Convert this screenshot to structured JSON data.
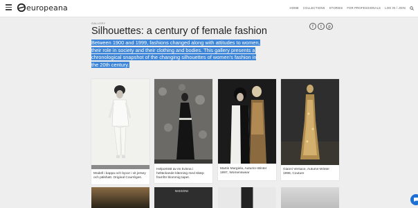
{
  "header": {
    "logo_text": "europeana",
    "nav": [
      "HOME",
      "COLLECTIONS",
      "STORIES",
      "FOR PROFESSIONALS",
      "LOG IN / JOIN"
    ]
  },
  "gallery": {
    "tag": "GALLERY",
    "title": "Silhouettes: a century of female fashion",
    "intro": "Between 1900 and 1999, fashions changed along with attitudes to women, their role in society and their clothing and bodies. This gallery presents a chronological snapshot of the changing silhouettes of women's fashion in the 20th century.",
    "share": [
      "f",
      "t",
      "p"
    ]
  },
  "items": [
    {
      "caption": "Modell i kappa och byxor i vit jersey och pälshatt. Original Courrèges."
    },
    {
      "caption": "Helporträtt av en kvinna i heltäckande klänning med skärp framför blommig tapet."
    },
    {
      "caption": "Martin Margiela, Autumn-Winter 1997, Womenswear"
    },
    {
      "caption": "Gianni Versace, Autumn-Winter 1998, Couture"
    }
  ],
  "row2": {
    "brand": "NISSONI"
  },
  "colors": {
    "accent": "#1e6fd4",
    "selection": "#3d85d8",
    "background": "#eeeeee"
  }
}
